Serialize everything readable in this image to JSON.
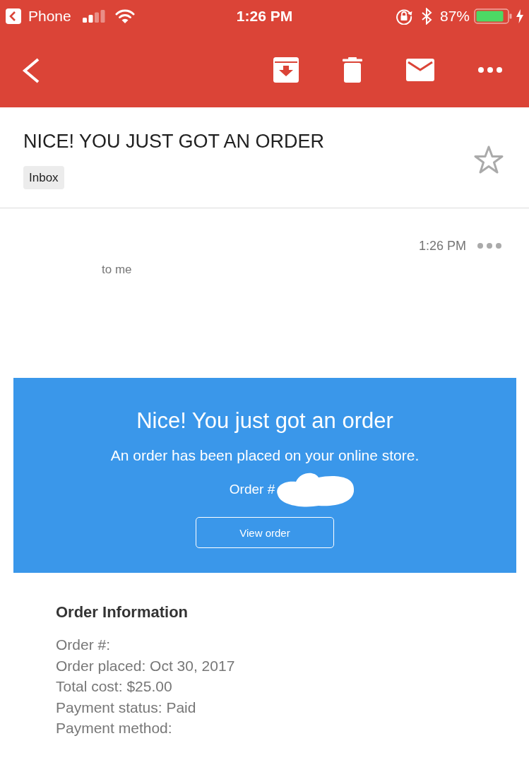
{
  "status_bar": {
    "back_app": "Phone",
    "time": "1:26 PM",
    "battery": "87%"
  },
  "message": {
    "subject": "NICE! YOU JUST GOT AN ORDER",
    "label": "Inbox",
    "starred": false,
    "time": "1:26 PM",
    "recipient": "to me"
  },
  "banner": {
    "title": "Nice! You just got an order",
    "subtitle": "An order has been placed on your online store.",
    "order_number": "Order #",
    "button": "View order"
  },
  "order_information": {
    "title": "Order Information",
    "lines": [
      "Order #:",
      "Order placed: Oct 30, 2017",
      "Total cost: $25.00",
      "Payment status: Paid",
      "Payment method:"
    ]
  }
}
